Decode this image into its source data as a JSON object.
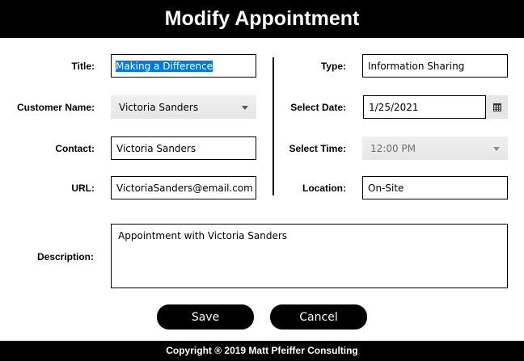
{
  "window": {
    "title": "Modify Appointment"
  },
  "labels": {
    "title": "Title:",
    "customer_name": "Customer Name:",
    "contact": "Contact:",
    "url": "URL:",
    "type": "Type:",
    "select_date": "Select Date:",
    "select_time": "Select Time:",
    "location": "Location:",
    "description": "Description:"
  },
  "fields": {
    "title": "Making a Difference",
    "customer_name": "Victoria Sanders",
    "contact": "Victoria Sanders",
    "url": "VictoriaSanders@email.com",
    "type": "Information Sharing",
    "date": "1/25/2021",
    "time": "12:00 PM",
    "location": "On-Site",
    "description": "Appointment with Victoria Sanders"
  },
  "buttons": {
    "save": "Save",
    "cancel": "Cancel"
  },
  "icons": {
    "date_picker": "calendar-icon",
    "dropdown": "chevron-down-icon"
  },
  "colors": {
    "header_bg": "#000000",
    "selection": "#0078d7",
    "button_bg": "#000000"
  },
  "footer": {
    "text": "Copyright ® 2019 Matt Pfeiffer Consulting"
  }
}
